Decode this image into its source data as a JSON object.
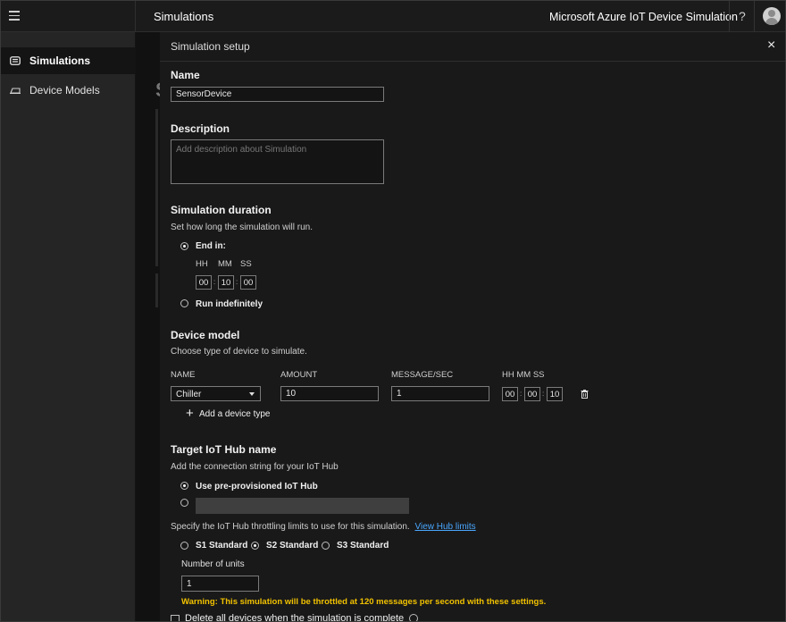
{
  "topbar": {
    "section_title": "Simulations",
    "product_name": "Microsoft Azure IoT Device Simulation",
    "help_icon": "?"
  },
  "sidenav": {
    "items": [
      {
        "label": "Simulations",
        "icon": "simulations-icon",
        "active": true
      },
      {
        "label": "Device Models",
        "icon": "device-models-icon",
        "active": false
      }
    ]
  },
  "background_page": {
    "heading_glyph": "S"
  },
  "flyout": {
    "title": "Simulation setup",
    "close_glyph": "×",
    "name": {
      "label": "Name",
      "value": "SensorDevice"
    },
    "description": {
      "label": "Description",
      "placeholder": "Add description about Simulation"
    },
    "duration": {
      "label": "Simulation duration",
      "help": "Set how long the simulation will run.",
      "end_in_label": "End in:",
      "hh_label": "HH",
      "mm_label": "MM",
      "ss_label": "SS",
      "hh": "00",
      "mm": "10",
      "ss": "00",
      "run_indefinitely_label": "Run indefinitely",
      "selected": "end_in"
    },
    "device_model": {
      "label": "Device model",
      "help": "Choose type of device to simulate.",
      "columns": [
        "NAME",
        "AMOUNT",
        "MESSAGE/SEC",
        "HH MM SS"
      ],
      "row": {
        "name": "Chiller",
        "amount": "10",
        "message_sec": "1",
        "hh": "00",
        "mm": "00",
        "ss": "10"
      },
      "add_label": "Add a device type"
    },
    "iot_hub": {
      "label": "Target IoT Hub name",
      "help": "Add the connection string for your IoT Hub",
      "preprovisioned_label": "Use pre-provisioned IoT Hub",
      "throttle_text": "Specify the IoT Hub throttling limits to use for this simulation.",
      "view_limits_link": "View Hub limits",
      "tiers": [
        "S1 Standard",
        "S2 Standard",
        "S3 Standard"
      ],
      "selected_tier": "S2 Standard",
      "units_label": "Number of units",
      "units_value": "1",
      "warning_prefix": "Warning:",
      "warning_text": "This simulation will be throttled at 120 messages per second with these settings.",
      "delete_devices_label": "Delete all devices when the simulation is complete"
    }
  },
  "colors": {
    "accent_link": "#49a7ff",
    "warning": "#f2c200",
    "background": "#191919"
  }
}
